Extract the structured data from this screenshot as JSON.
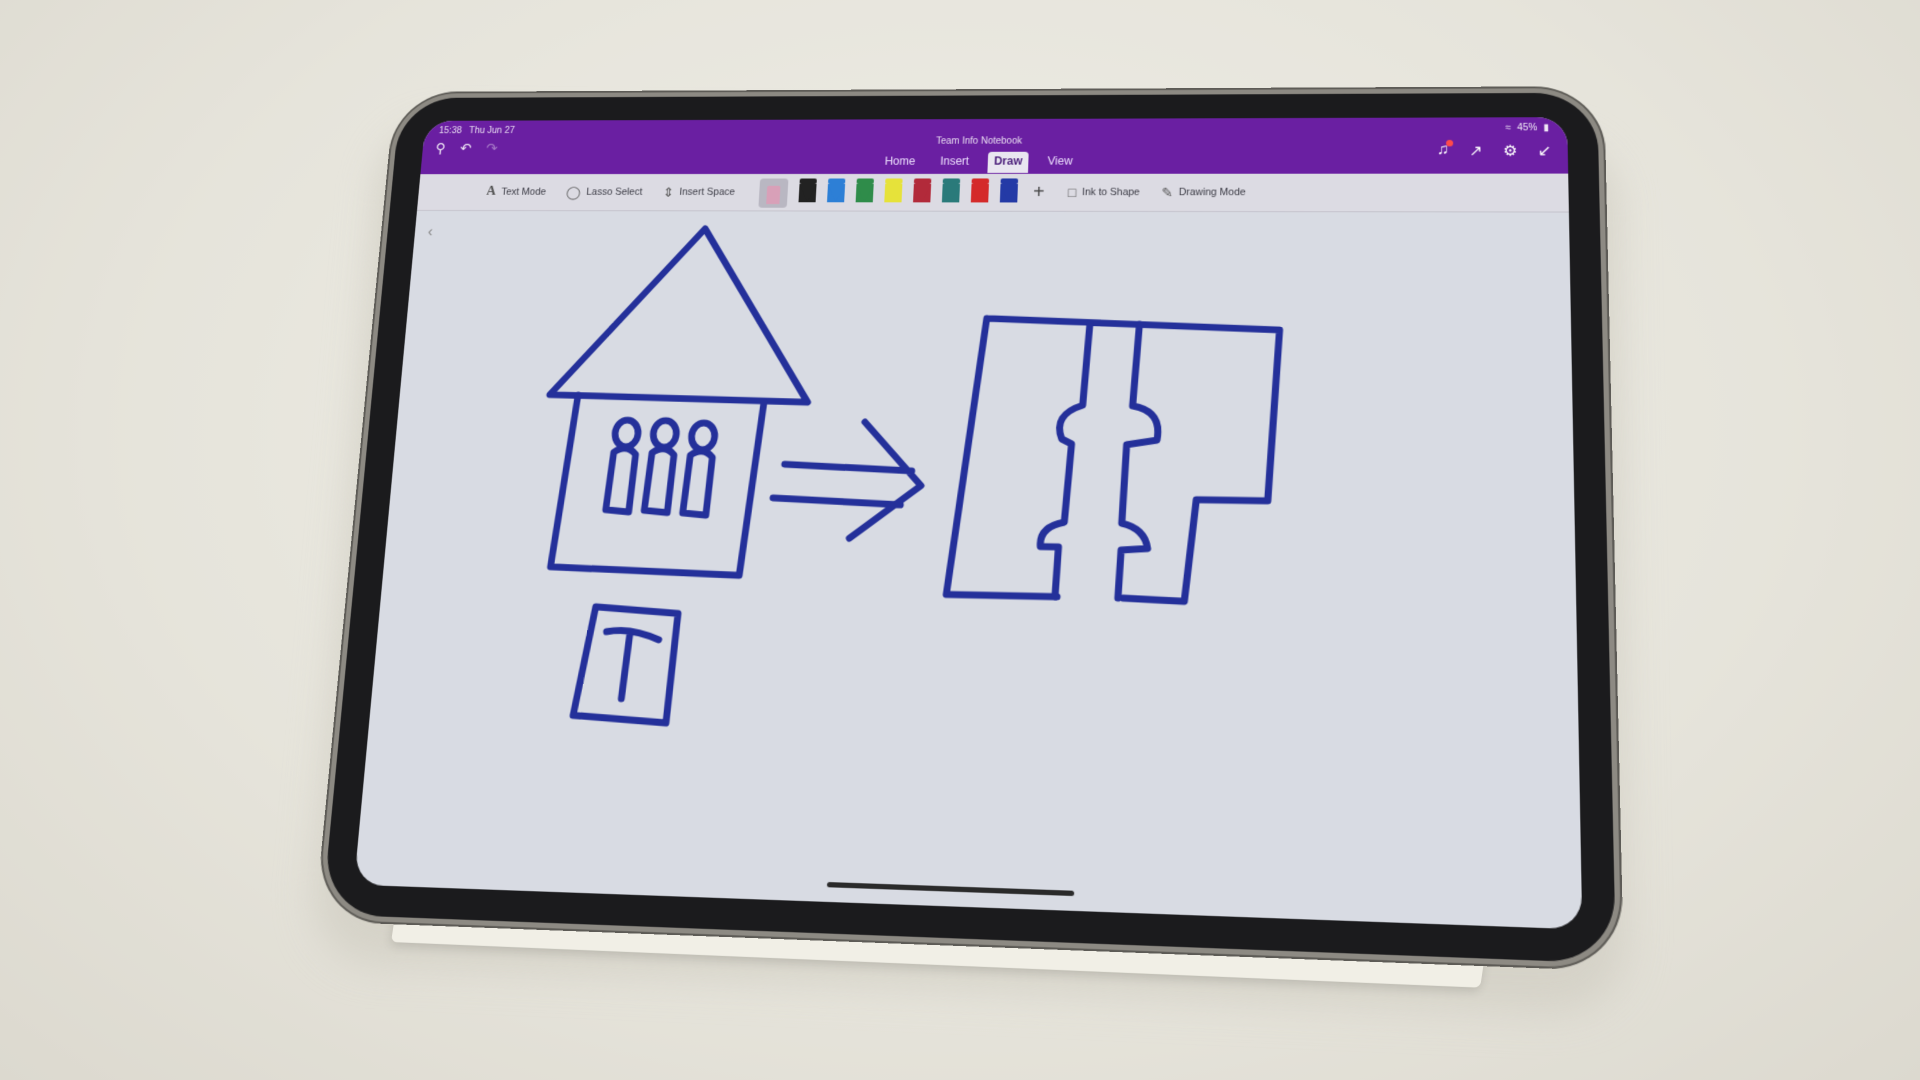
{
  "status": {
    "time": "15:38",
    "date": "Thu Jun 27",
    "battery": "45%"
  },
  "app": {
    "document_title": "Team Info Notebook"
  },
  "tabs": [
    {
      "label": "Home"
    },
    {
      "label": "Insert"
    },
    {
      "label": "Draw",
      "active": true
    },
    {
      "label": "View"
    }
  ],
  "ribbon": {
    "text_mode": "Text Mode",
    "lasso_select": "Lasso Select",
    "insert_space": "Insert Space",
    "ink_to_shape": "Ink to Shape",
    "drawing_mode": "Drawing Mode",
    "pens": [
      {
        "name": "black-pen",
        "color": "#222222"
      },
      {
        "name": "blue-pen",
        "color": "#2d7fd6"
      },
      {
        "name": "green-pen",
        "color": "#2f8c4a"
      },
      {
        "name": "yellow-highlighter",
        "color": "#e6e23a"
      },
      {
        "name": "red-pen-1",
        "color": "#b22a3a"
      },
      {
        "name": "teal-pen",
        "color": "#2a7a7a"
      },
      {
        "name": "red-pen-2",
        "color": "#d42a2a"
      },
      {
        "name": "navy-pen",
        "color": "#243aa6"
      }
    ],
    "selected_pen_color": "#d8a0b8"
  },
  "ink": {
    "color": "#24309a"
  },
  "icons": [
    "search-icon",
    "undo-icon",
    "redo-icon",
    "bell-icon",
    "share-icon",
    "gear-icon",
    "collapse-icon",
    "wifi-icon",
    "battery-icon"
  ]
}
